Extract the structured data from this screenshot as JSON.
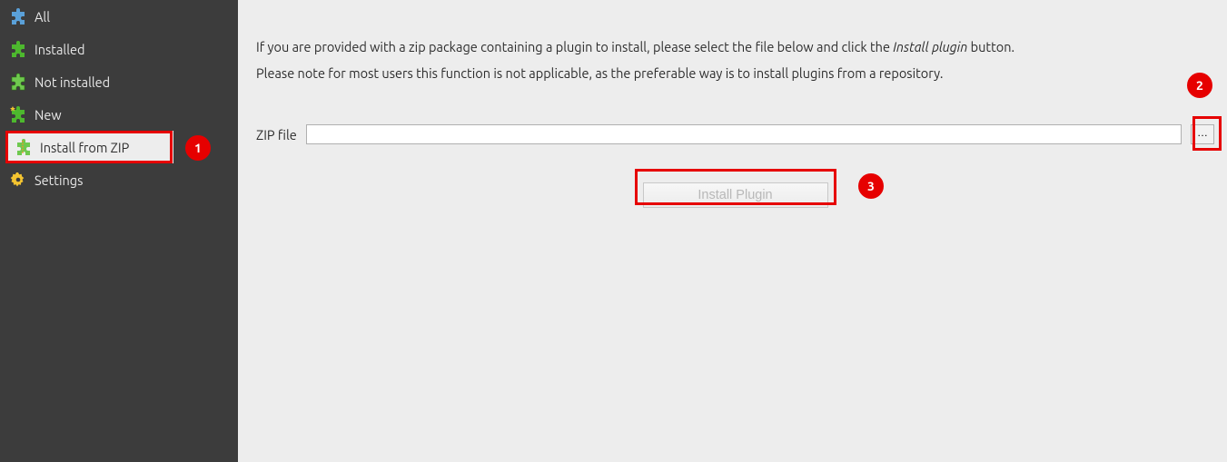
{
  "sidebar": {
    "items": [
      {
        "label": "All"
      },
      {
        "label": "Installed"
      },
      {
        "label": "Not installed"
      },
      {
        "label": "New"
      },
      {
        "label": "Install from ZIP"
      },
      {
        "label": "Settings"
      }
    ]
  },
  "main": {
    "instruction_part1": "If you are provided with a zip package containing a plugin to install, please select the file below and click the ",
    "instruction_emph": "Install plugin",
    "instruction_part2": " button.",
    "instruction_line2": "Please note for most users this function is not applicable, as the preferable way is to install plugins from a repository.",
    "zip_label": "ZIP file",
    "zip_value": "",
    "browse_label": "…",
    "install_label": "Install Plugin"
  },
  "callouts": {
    "c1": "1",
    "c2": "2",
    "c3": "3"
  }
}
